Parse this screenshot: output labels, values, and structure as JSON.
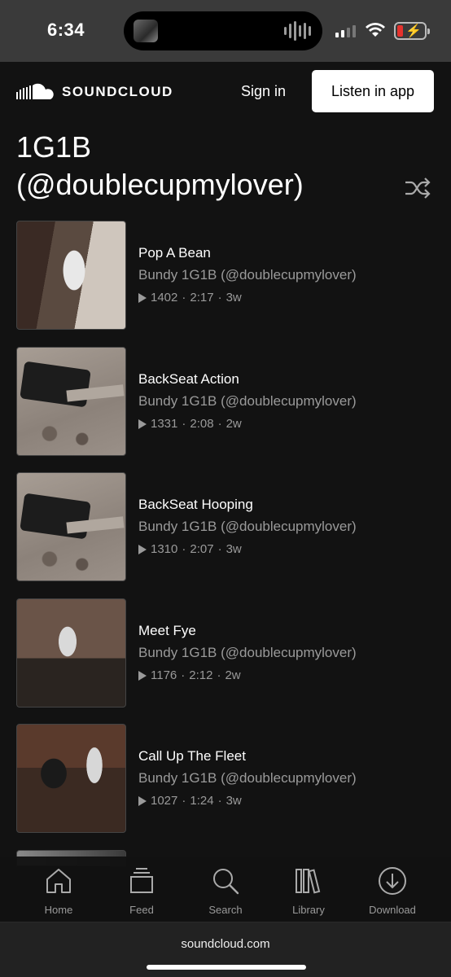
{
  "status_bar": {
    "time": "6:34"
  },
  "header": {
    "logo_text": "SOUNDCLOUD",
    "sign_in": "Sign in",
    "listen_in_app": "Listen in app"
  },
  "playlist": {
    "title_line_1": "1G1B",
    "title_line_2": "(@doublecupmylover)"
  },
  "tracks": [
    {
      "name": "Pop A Bean",
      "artist": "Bundy 1G1B (@doublecupmylover)",
      "plays": "1402",
      "duration": "2:17",
      "age": "3w"
    },
    {
      "name": "BackSeat Action",
      "artist": "Bundy 1G1B (@doublecupmylover)",
      "plays": "1331",
      "duration": "2:08",
      "age": "2w"
    },
    {
      "name": "BackSeat Hooping",
      "artist": "Bundy 1G1B (@doublecupmylover)",
      "plays": "1310",
      "duration": "2:07",
      "age": "3w"
    },
    {
      "name": "Meet Fye",
      "artist": "Bundy 1G1B (@doublecupmylover)",
      "plays": "1176",
      "duration": "2:12",
      "age": "2w"
    },
    {
      "name": "Call Up The Fleet",
      "artist": "Bundy 1G1B (@doublecupmylover)",
      "plays": "1027",
      "duration": "1:24",
      "age": "3w"
    }
  ],
  "meta_separator": "·",
  "nav": {
    "home": "Home",
    "feed": "Feed",
    "search": "Search",
    "library": "Library",
    "download": "Download"
  },
  "footer": {
    "url": "soundcloud.com"
  },
  "colors": {
    "background": "#121212",
    "muted_text": "#9a9a9a",
    "accent_button": "#ffffff"
  }
}
